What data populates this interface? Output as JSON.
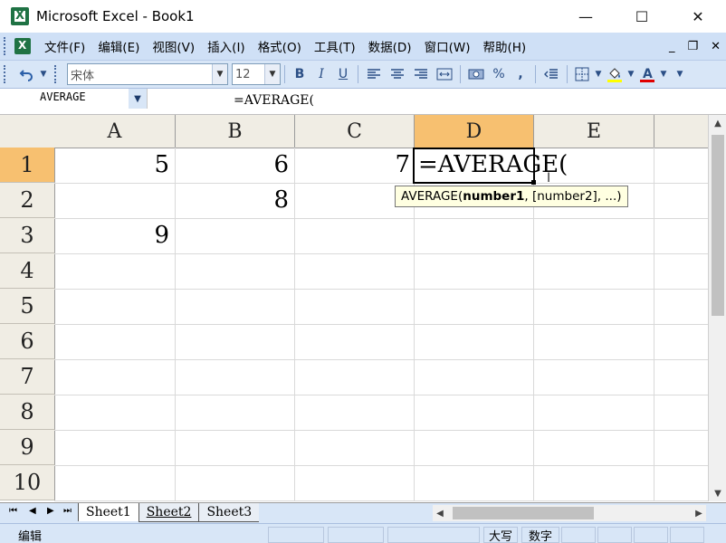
{
  "window": {
    "title": "Microsoft Excel - Book1",
    "minimize": "—",
    "maximize": "☐",
    "close": "✕"
  },
  "menu": {
    "items": [
      "文件(F)",
      "编辑(E)",
      "视图(V)",
      "插入(I)",
      "格式(O)",
      "工具(T)",
      "数据(D)",
      "窗口(W)",
      "帮助(H)"
    ],
    "doc_minimize": "_",
    "doc_restore": "❐",
    "doc_close": "✕"
  },
  "toolbar": {
    "font_name": "宋体",
    "font_size": "12",
    "bold": "B",
    "italic": "I",
    "underline": "U",
    "percent": "%",
    "comma": ","
  },
  "formula_bar": {
    "name_box": "AVERAGE",
    "formula": "=AVERAGE("
  },
  "grid": {
    "columns": [
      "A",
      "B",
      "C",
      "D",
      "E"
    ],
    "rows": [
      "1",
      "2",
      "3",
      "4",
      "5",
      "6",
      "7",
      "8",
      "9",
      "10"
    ],
    "cells": {
      "A1": "5",
      "B1": "6",
      "C1": "7",
      "B2": "8",
      "A3": "9"
    },
    "editing_cell": "D1",
    "editing_text": "=AVERAGE(",
    "tooltip": {
      "func": "AVERAGE(",
      "arg1": "number1",
      "rest": ", [number2], ...)"
    }
  },
  "sheets": {
    "tabs": [
      "Sheet1",
      "Sheet2",
      "Sheet3"
    ],
    "active": "Sheet1"
  },
  "status": {
    "mode": "编辑",
    "caps": "大写",
    "num": "数字"
  },
  "colors": {
    "active_header": "#f7c070",
    "header_bg": "#f0ede4",
    "toolbar_bg": "#d8e6f7",
    "tooltip_bg": "#ffffe1"
  }
}
